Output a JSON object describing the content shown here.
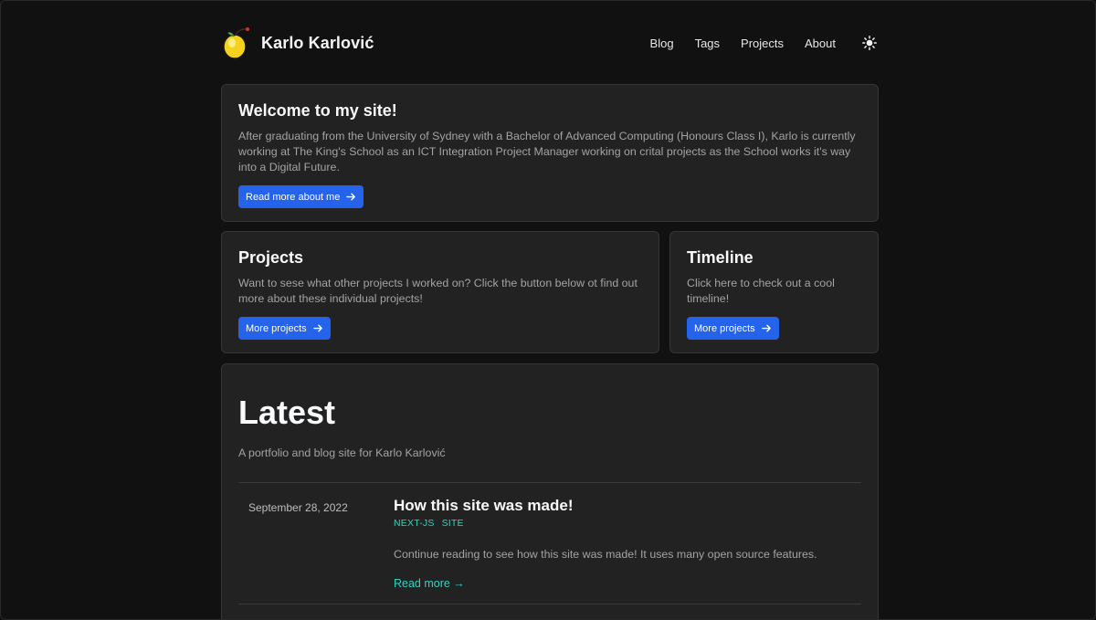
{
  "site": {
    "name": "Karlo Karlović"
  },
  "nav": [
    {
      "label": "Blog"
    },
    {
      "label": "Tags"
    },
    {
      "label": "Projects"
    },
    {
      "label": "About"
    }
  ],
  "welcome": {
    "title": "Welcome to my site!",
    "body": "After graduating from the University of Sydney with a Bachelor of Advanced Computing (Honours Class I), Karlo is currently working at The King's School as an ICT Integration Project Manager working on crital projects as the School works it's way into a Digital Future.",
    "button": "Read more about me"
  },
  "projects": {
    "title": "Projects",
    "body": "Want to sese what other projects I worked on? Click the button below ot find out more about these individual projects!",
    "button": "More projects"
  },
  "timeline": {
    "title": "Timeline",
    "body": "Click here to check out a cool timeline!",
    "button": "More projects"
  },
  "latest": {
    "title": "Latest",
    "subtitle": "A portfolio and blog site for Karlo Karlović",
    "posts": [
      {
        "date": "September 28, 2022",
        "title": "How this site was made!",
        "tags": [
          "NEXT-JS",
          "SITE"
        ],
        "summary": "Continue reading to see how this site was made! It uses many open source features.",
        "read_more": "Read more →"
      }
    ]
  },
  "colors": {
    "accent_button": "#2563eb",
    "link_teal": "#2dd4bf",
    "background": "#111111",
    "card": "#222222"
  },
  "icons": {
    "logo": "lemon-logo-icon",
    "theme": "sun-icon",
    "arrow": "arrow-right-icon"
  }
}
